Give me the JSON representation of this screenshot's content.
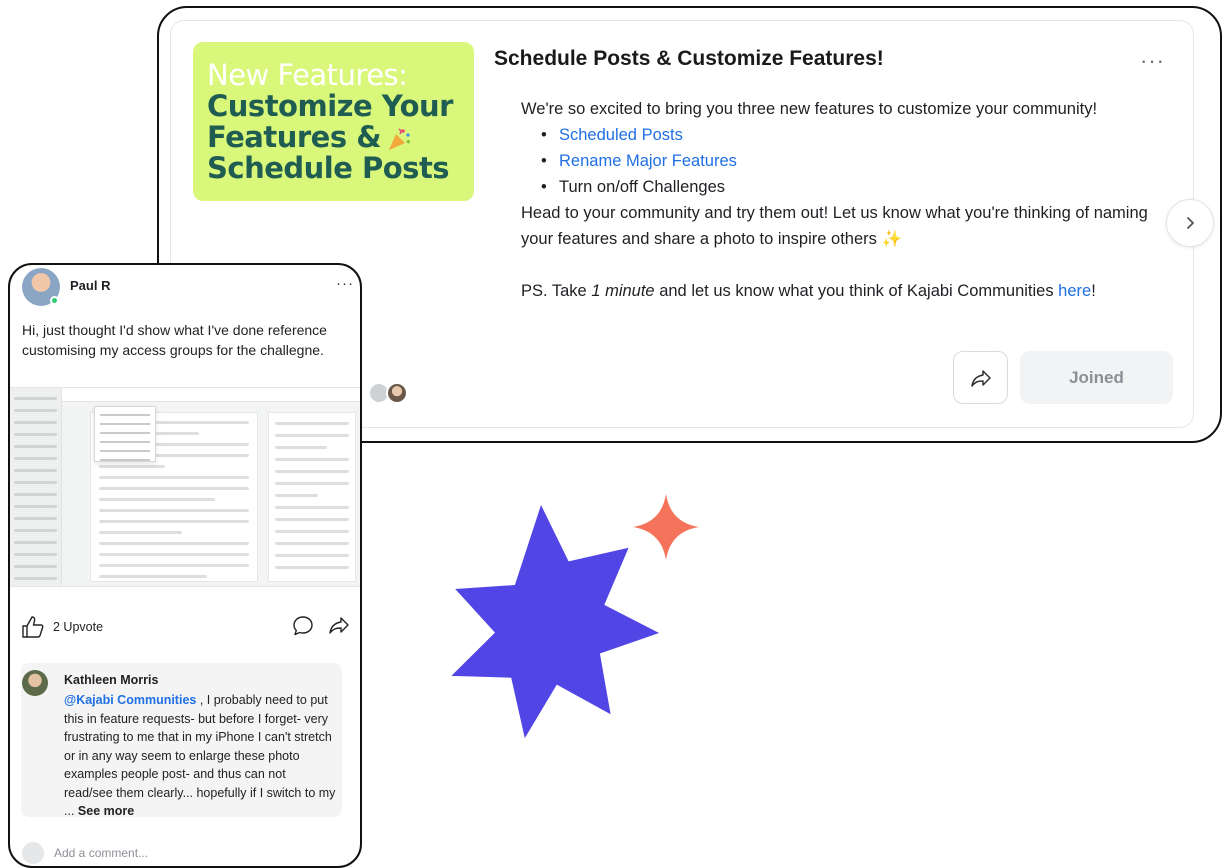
{
  "announcement": {
    "promo_line1": "New Features:",
    "promo_line2": "Customize Your",
    "promo_line3": "Features &",
    "promo_line4": "Schedule Posts",
    "title": "Schedule Posts & Customize Features!",
    "menu": "···",
    "intro": "We're so excited to bring you three new features to customize your community!",
    "bullets": [
      "Scheduled Posts",
      "Rename Major Features",
      "Turn on/off Challenges"
    ],
    "body2": "Head to your community and try them out! Let us know what you're thinking of naming your features and share a photo to inspire others",
    "ps_prefix": "PS. Take ",
    "ps_emph": "1 minute",
    "ps_suffix": " and let us know what you think of Kajabi Communities ",
    "ps_link": "here",
    "ps_end": "!",
    "joined_label": "Joined",
    "colors": {
      "promo_bg": "#d9f77a",
      "promo_text": "#1f5c52",
      "link": "#1f6fe5"
    }
  },
  "post": {
    "author": "Paul R",
    "menu": "···",
    "text": "Hi, just thought I'd show what I've done reference customising my access groups for the challegne.",
    "upvotes_label": "2 Upvote"
  },
  "comment": {
    "author": "Kathleen Morris",
    "mention": "@Kajabi Communities",
    "text": " , I probably need to put this in feature requests- but before I forget- very frustrating to me that in my iPhone I can't stretch or in any way seem to enlarge these photo examples people post- and thus can not read/see them clearly... hopefully if I switch to my ...",
    "see_more": "See more",
    "add_placeholder": "Add a comment..."
  },
  "decor": {
    "starburst_color": "#5145e5",
    "sparkle_color": "#f5735a"
  }
}
